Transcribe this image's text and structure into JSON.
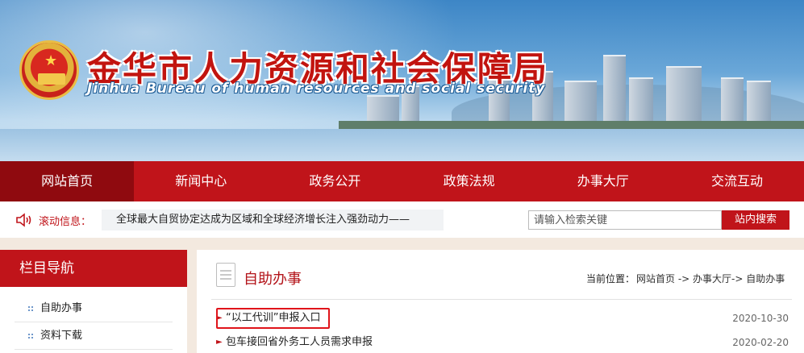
{
  "header": {
    "title_cn": "金华市人力资源和社会保障局",
    "title_en": "Jinhua Bureau of human resources and social security",
    "emblem_icon": "national-emblem-icon"
  },
  "nav": {
    "items": [
      {
        "label": "网站首页",
        "active": true
      },
      {
        "label": "新闻中心",
        "active": false
      },
      {
        "label": "政务公开",
        "active": false
      },
      {
        "label": "政策法规",
        "active": false
      },
      {
        "label": "办事大厅",
        "active": false
      },
      {
        "label": "交流互动",
        "active": false
      }
    ]
  },
  "infobar": {
    "scroll_label": "滚动信息：",
    "ticker_text": "全球最大自贸协定达成为区域和全球经济增长注入强劲动力——",
    "search_placeholder": "请输入检索关键",
    "search_button": "站内搜索"
  },
  "sidebar": {
    "heading": "栏目导航",
    "items": [
      {
        "label": "自助办事"
      },
      {
        "label": "资料下载"
      }
    ]
  },
  "main": {
    "title": "自助办事",
    "breadcrumb_label": "当前位置：",
    "breadcrumb_path": "网站首页 -> 办事大厅-> 自助办事",
    "rows": [
      {
        "title": "“以工代训”申报入口",
        "date": "2020-10-30",
        "highlighted": true
      },
      {
        "title": "包车接回省外务工人员需求申报",
        "date": "2020-02-20",
        "highlighted": false
      }
    ]
  },
  "colors": {
    "brand_red": "#c0141a",
    "nav_active": "#8f0a0f",
    "highlight_border": "#e0141a"
  }
}
